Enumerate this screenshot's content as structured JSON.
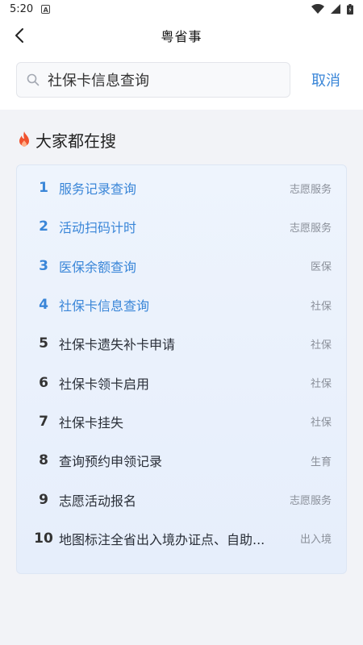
{
  "status": {
    "time": "5:20"
  },
  "header": {
    "title": "粤省事"
  },
  "search": {
    "value": "社保卡信息查询",
    "cancel_label": "取消"
  },
  "section": {
    "title": "大家都在搜"
  },
  "colors": {
    "accent": "#3a86d8",
    "flame": "#f0522e",
    "card_bg": "#eaf1fc"
  },
  "hot_list": [
    {
      "rank": "1",
      "name": "服务记录查询",
      "category": "志愿服务"
    },
    {
      "rank": "2",
      "name": "活动扫码计时",
      "category": "志愿服务"
    },
    {
      "rank": "3",
      "name": "医保余额查询",
      "category": "医保"
    },
    {
      "rank": "4",
      "name": "社保卡信息查询",
      "category": "社保"
    },
    {
      "rank": "5",
      "name": "社保卡遗失补卡申请",
      "category": "社保"
    },
    {
      "rank": "6",
      "name": "社保卡领卡启用",
      "category": "社保"
    },
    {
      "rank": "7",
      "name": "社保卡挂失",
      "category": "社保"
    },
    {
      "rank": "8",
      "name": "查询预约申领记录",
      "category": "生育"
    },
    {
      "rank": "9",
      "name": "志愿活动报名",
      "category": "志愿服务"
    },
    {
      "rank": "10",
      "name": "地图标注全省出入境办证点、自助...",
      "category": "出入境"
    }
  ]
}
